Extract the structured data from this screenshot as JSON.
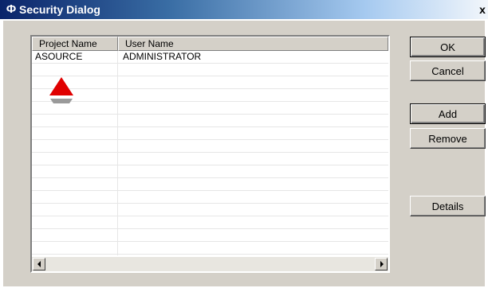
{
  "window": {
    "title": "Security Dialog",
    "icon": "app-icon",
    "close_label": "x"
  },
  "list": {
    "columns": [
      "Project Name",
      "User Name"
    ],
    "rows": [
      {
        "project": "ASOURCE",
        "user": "ADMINISTRATOR"
      }
    ],
    "empty_rows": 15
  },
  "buttons": {
    "ok": "OK",
    "cancel": "Cancel",
    "add": "Add",
    "remove": "Remove",
    "details": "Details"
  },
  "annotation": {
    "arrow_color": "#e00000",
    "shadow_color": "#9a9a9a",
    "icon": "red-up-arrow-icon"
  },
  "colors": {
    "title_start": "#0a246a",
    "dialog_face": "#d4d0c8"
  }
}
